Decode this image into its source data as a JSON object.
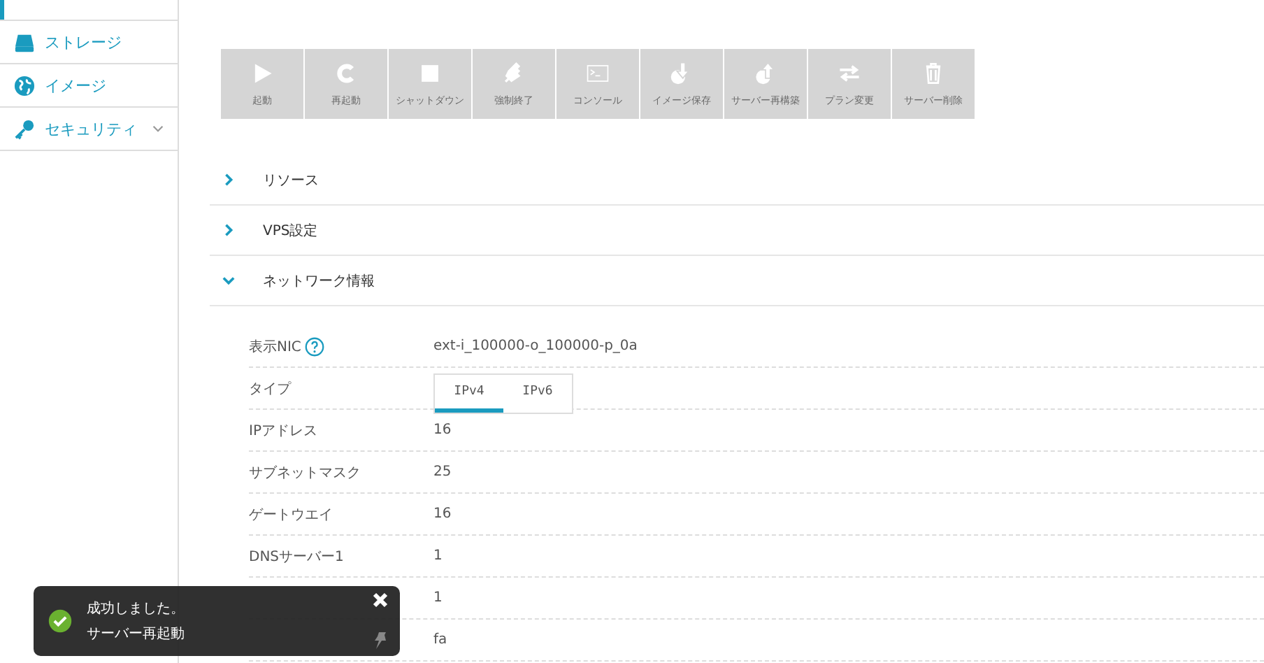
{
  "sidebar": {
    "items": [
      {
        "label": "ストレージ",
        "expandable": false
      },
      {
        "label": "イメージ",
        "expandable": false
      },
      {
        "label": "セキュリティ",
        "expandable": true
      }
    ]
  },
  "toolbar": [
    {
      "label": "起動",
      "disabled": true
    },
    {
      "label": "再起動",
      "disabled": true
    },
    {
      "label": "シャットダウン",
      "disabled": true
    },
    {
      "label": "強制終了",
      "disabled": true
    },
    {
      "label": "コンソール",
      "disabled": true
    },
    {
      "label": "イメージ保存",
      "disabled": true
    },
    {
      "label": "サーバー再構築",
      "disabled": true
    },
    {
      "label": "プラン変更",
      "disabled": true
    },
    {
      "label": "サーバー削除",
      "disabled": true
    }
  ],
  "sections": [
    {
      "title": "リソース",
      "expanded": false
    },
    {
      "title": "VPS設定",
      "expanded": false
    },
    {
      "title": "ネットワーク情報",
      "expanded": true
    }
  ],
  "network": {
    "rows": [
      {
        "kind": "text",
        "label": "表示NIC",
        "help": true,
        "value": "ext-i_100000-o_100000-p_0a"
      },
      {
        "kind": "tabs",
        "label": "タイプ",
        "help": false,
        "tabs": [
          {
            "label": "IPv4",
            "selected": true
          },
          {
            "label": "IPv6",
            "selected": false
          }
        ]
      },
      {
        "kind": "text",
        "label": "IPアドレス",
        "help": false,
        "value": "16"
      },
      {
        "kind": "text",
        "label": "サブネットマスク",
        "help": false,
        "value": "25"
      },
      {
        "kind": "text",
        "label": "ゲートウエイ",
        "help": false,
        "value": "16"
      },
      {
        "kind": "text",
        "label": "DNSサーバー1",
        "help": false,
        "value": "1"
      },
      {
        "kind": "text",
        "help": false,
        "value": "1"
      },
      {
        "kind": "text",
        "help": false,
        "value": "fa"
      }
    ]
  },
  "toast": {
    "lines": [
      "成功しました。",
      "サーバー再起動"
    ]
  }
}
